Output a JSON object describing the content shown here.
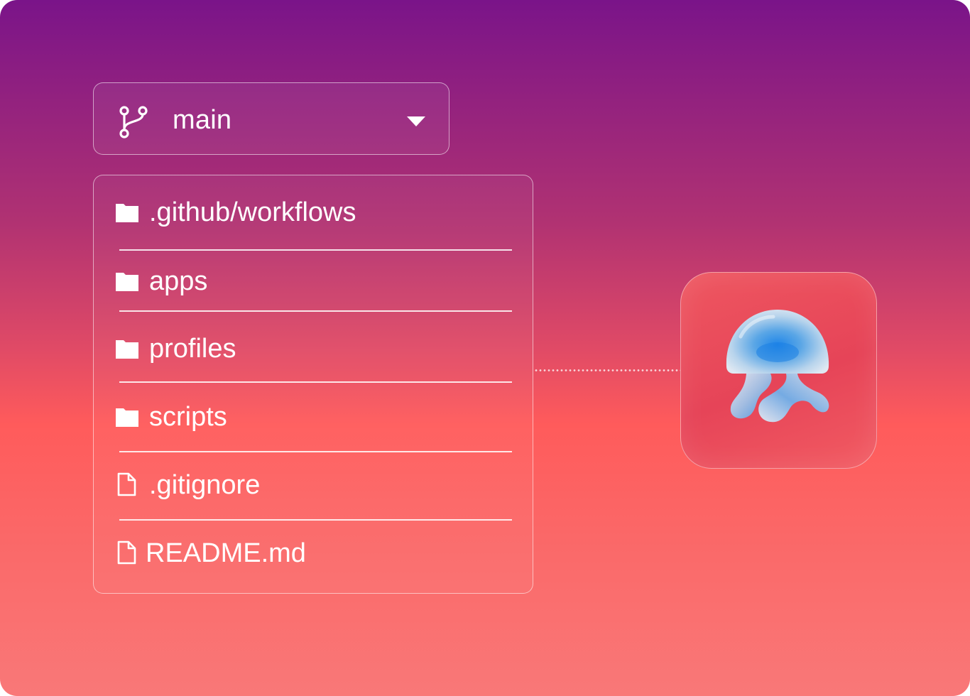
{
  "branch": {
    "name": "main",
    "icon": "git-branch-icon",
    "caret_icon": "chevron-down-icon"
  },
  "files": {
    "items": [
      {
        "name": ".github/workflows",
        "type": "folder",
        "icon": "folder-icon"
      },
      {
        "name": "apps",
        "type": "folder",
        "icon": "folder-icon"
      },
      {
        "name": "profiles",
        "type": "folder",
        "icon": "folder-icon"
      },
      {
        "name": "scripts",
        "type": "folder",
        "icon": "folder-icon"
      },
      {
        "name": ".gitignore",
        "type": "file",
        "icon": "file-icon"
      },
      {
        "name": "README.md",
        "type": "file",
        "icon": "file-icon"
      }
    ]
  },
  "app": {
    "logo": "jellyfish-logo-icon"
  },
  "colors": {
    "gradient_top": "#7a1489",
    "gradient_mid": "#ff5b5b",
    "gradient_bottom": "#f97878",
    "tile": "#e64458",
    "text": "#ffffff"
  }
}
